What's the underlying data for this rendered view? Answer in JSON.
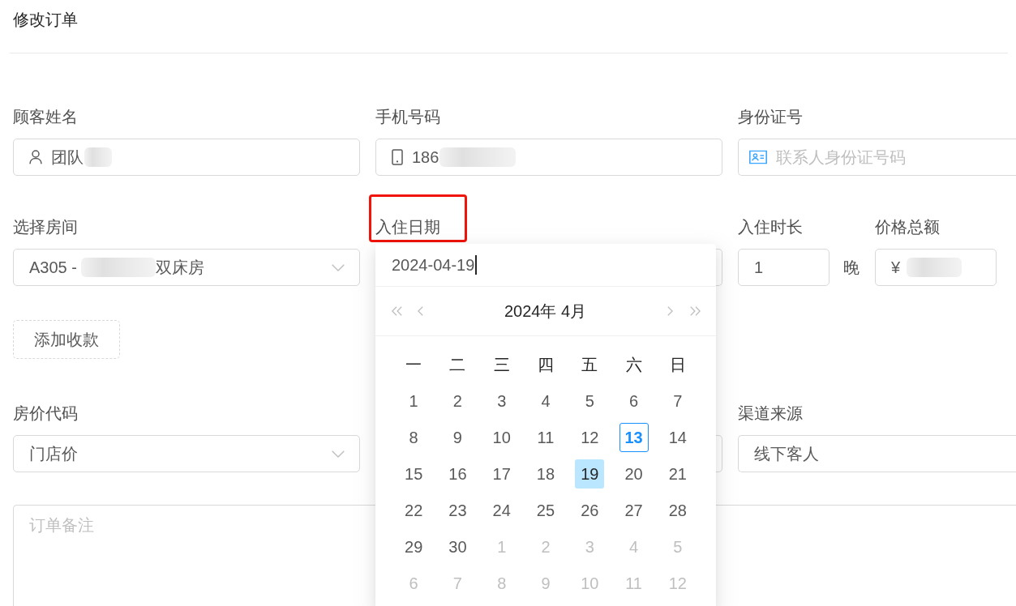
{
  "page_title": "修改订单",
  "sections": [
    {
      "kind": "fields",
      "items": [
        {
          "kind": "name",
          "label": "顾客姓名",
          "value": "团队",
          "blurred": true
        },
        {
          "kind": "phone",
          "label": "手机号码",
          "value": "186",
          "blurred": true
        },
        {
          "kind": "idcard",
          "label": "身份证号",
          "placeholder": "联系人身份证号码"
        }
      ]
    },
    {
      "kind": "fields",
      "items": [
        {
          "kind": "select",
          "label": "选择房间",
          "value": "A305 -",
          "blurred": true,
          "value_tail": "双床房"
        },
        {
          "kind": "date",
          "label": "入住日期",
          "highlighted": true,
          "picker": {
            "value": "2024-04-19",
            "focused": true,
            "title": "2024年 4月",
            "weekdays": [
              "一",
              "二",
              "三",
              "四",
              "五",
              "六",
              "日"
            ],
            "weeks": [
              {
                "days": [
                  {
                    "day": "1",
                    "in_month": true,
                    "today": false,
                    "selected": false
                  },
                  {
                    "day": "2",
                    "in_month": true,
                    "today": false,
                    "selected": false
                  },
                  {
                    "day": "3",
                    "in_month": true,
                    "today": false,
                    "selected": false
                  },
                  {
                    "day": "4",
                    "in_month": true,
                    "today": false,
                    "selected": false
                  },
                  {
                    "day": "5",
                    "in_month": true,
                    "today": false,
                    "selected": false
                  },
                  {
                    "day": "6",
                    "in_month": true,
                    "today": false,
                    "selected": false
                  },
                  {
                    "day": "7",
                    "in_month": true,
                    "today": false,
                    "selected": false
                  }
                ]
              },
              {
                "days": [
                  {
                    "day": "8",
                    "in_month": true,
                    "today": false,
                    "selected": false
                  },
                  {
                    "day": "9",
                    "in_month": true,
                    "today": false,
                    "selected": false
                  },
                  {
                    "day": "10",
                    "in_month": true,
                    "today": false,
                    "selected": false
                  },
                  {
                    "day": "11",
                    "in_month": true,
                    "today": false,
                    "selected": false
                  },
                  {
                    "day": "12",
                    "in_month": true,
                    "today": false,
                    "selected": false
                  },
                  {
                    "day": "13",
                    "in_month": true,
                    "today": true,
                    "selected": false
                  },
                  {
                    "day": "14",
                    "in_month": true,
                    "today": false,
                    "selected": false
                  }
                ]
              },
              {
                "days": [
                  {
                    "day": "15",
                    "in_month": true,
                    "today": false,
                    "selected": false
                  },
                  {
                    "day": "16",
                    "in_month": true,
                    "today": false,
                    "selected": false
                  },
                  {
                    "day": "17",
                    "in_month": true,
                    "today": false,
                    "selected": false
                  },
                  {
                    "day": "18",
                    "in_month": true,
                    "today": false,
                    "selected": false
                  },
                  {
                    "day": "19",
                    "in_month": true,
                    "today": false,
                    "selected": true
                  },
                  {
                    "day": "20",
                    "in_month": true,
                    "today": false,
                    "selected": false
                  },
                  {
                    "day": "21",
                    "in_month": true,
                    "today": false,
                    "selected": false
                  }
                ]
              },
              {
                "days": [
                  {
                    "day": "22",
                    "in_month": true,
                    "today": false,
                    "selected": false
                  },
                  {
                    "day": "23",
                    "in_month": true,
                    "today": false,
                    "selected": false
                  },
                  {
                    "day": "24",
                    "in_month": true,
                    "today": false,
                    "selected": false
                  },
                  {
                    "day": "25",
                    "in_month": true,
                    "today": false,
                    "selected": false
                  },
                  {
                    "day": "26",
                    "in_month": true,
                    "today": false,
                    "selected": false
                  },
                  {
                    "day": "27",
                    "in_month": true,
                    "today": false,
                    "selected": false
                  },
                  {
                    "day": "28",
                    "in_month": true,
                    "today": false,
                    "selected": false
                  }
                ]
              },
              {
                "days": [
                  {
                    "day": "29",
                    "in_month": true,
                    "today": false,
                    "selected": false
                  },
                  {
                    "day": "30",
                    "in_month": true,
                    "today": false,
                    "selected": false
                  },
                  {
                    "day": "1",
                    "in_month": false,
                    "today": false,
                    "selected": false
                  },
                  {
                    "day": "2",
                    "in_month": false,
                    "today": false,
                    "selected": false
                  },
                  {
                    "day": "3",
                    "in_month": false,
                    "today": false,
                    "selected": false
                  },
                  {
                    "day": "4",
                    "in_month": false,
                    "today": false,
                    "selected": false
                  },
                  {
                    "day": "5",
                    "in_month": false,
                    "today": false,
                    "selected": false
                  }
                ]
              },
              {
                "days": [
                  {
                    "day": "6",
                    "in_month": false,
                    "today": false,
                    "selected": false
                  },
                  {
                    "day": "7",
                    "in_month": false,
                    "today": false,
                    "selected": false
                  },
                  {
                    "day": "8",
                    "in_month": false,
                    "today": false,
                    "selected": false
                  },
                  {
                    "day": "9",
                    "in_month": false,
                    "today": false,
                    "selected": false
                  },
                  {
                    "day": "10",
                    "in_month": false,
                    "today": false,
                    "selected": false
                  },
                  {
                    "day": "11",
                    "in_month": false,
                    "today": false,
                    "selected": false
                  },
                  {
                    "day": "12",
                    "in_month": false,
                    "today": false,
                    "selected": false
                  }
                ]
              }
            ]
          }
        },
        {
          "kind": "nights",
          "label": "入住时长",
          "value": "1",
          "unit": "晚"
        },
        {
          "kind": "amount",
          "label": "价格总额",
          "value": "¥",
          "blurred": true
        }
      ]
    },
    {
      "kind": "action",
      "button": "添加收款"
    },
    {
      "kind": "fields",
      "items": [
        {
          "kind": "select",
          "label": "房价代码",
          "value": "门店价"
        },
        {
          "kind": "covered"
        },
        {
          "kind": "plain",
          "label": "渠道来源",
          "value": "线下客人"
        }
      ]
    },
    {
      "kind": "notes",
      "placeholder": "订单备注"
    }
  ]
}
